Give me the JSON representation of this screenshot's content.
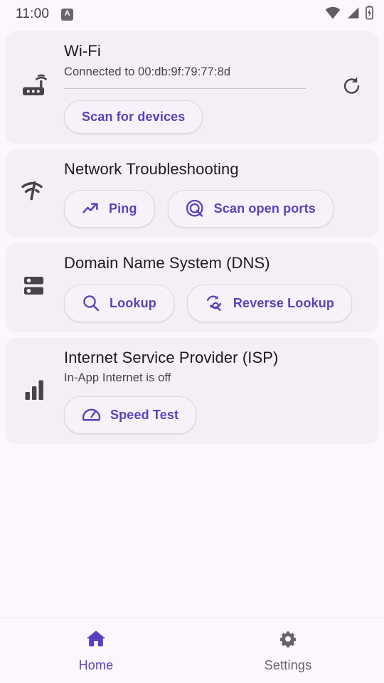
{
  "status_bar": {
    "time": "11:00",
    "notification_badge_letter": "A",
    "icons": [
      "wifi-icon",
      "cell-signal-icon",
      "battery-charging-icon"
    ]
  },
  "theme": {
    "background": "#fbf7fd",
    "card_background": "#f4eef6",
    "accent": "#5b3fbe",
    "icon_dark": "#46434b",
    "text_primary": "#1b1b1f",
    "text_secondary": "#46434b",
    "inactive_nav": "#66636b"
  },
  "cards": [
    {
      "id": "wifi",
      "leading_icon": "router-icon",
      "title": "Wi-Fi",
      "subtitle": "Connected to 00:db:9f:79:77:8d",
      "has_divider": true,
      "trailing_icon": "refresh-icon",
      "buttons": [
        {
          "label": "Scan for devices",
          "icon": "none"
        }
      ]
    },
    {
      "id": "network-troubleshooting",
      "leading_icon": "network-check-icon",
      "title": "Network Troubleshooting",
      "subtitle": "",
      "has_divider": false,
      "trailing_icon": "none",
      "buttons": [
        {
          "label": "Ping",
          "icon": "trending-up-icon"
        },
        {
          "label": "Scan open ports",
          "icon": "target-scan-icon"
        }
      ]
    },
    {
      "id": "dns",
      "leading_icon": "dns-server-icon",
      "title": "Domain Name System (DNS)",
      "subtitle": "",
      "has_divider": false,
      "trailing_icon": "none",
      "buttons": [
        {
          "label": "Lookup",
          "icon": "search-icon"
        },
        {
          "label": "Reverse Lookup",
          "icon": "search-refresh-icon"
        }
      ]
    },
    {
      "id": "isp",
      "leading_icon": "signal-bars-icon",
      "title": "Internet Service Provider (ISP)",
      "subtitle": "In-App Internet is off",
      "has_divider": false,
      "trailing_icon": "none",
      "buttons": [
        {
          "label": "Speed Test",
          "icon": "speedometer-icon"
        }
      ]
    }
  ],
  "bottom_nav": {
    "items": [
      {
        "label": "Home",
        "icon": "home-icon",
        "active": true
      },
      {
        "label": "Settings",
        "icon": "gear-icon",
        "active": false
      }
    ]
  }
}
